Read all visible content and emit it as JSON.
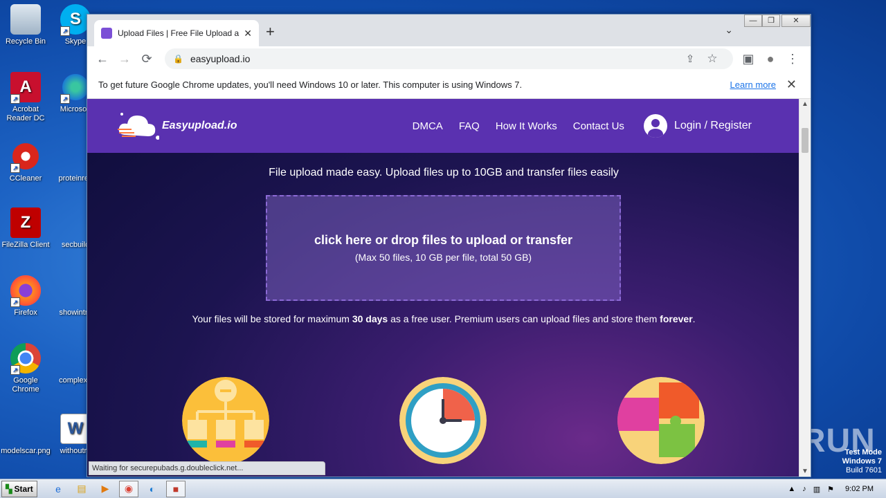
{
  "desktop": {
    "icons": [
      {
        "label": "Recycle Bin",
        "glyph": "🗑"
      },
      {
        "label": "Skype",
        "glyph": "S"
      },
      {
        "label": "Acrobat Reader DC",
        "glyph": "A"
      },
      {
        "label": "Microsoft",
        "glyph": "e"
      },
      {
        "label": "CCleaner",
        "glyph": "C"
      },
      {
        "label": "proteinrec",
        "glyph": ""
      },
      {
        "label": "FileZilla Client",
        "glyph": "Z"
      },
      {
        "label": "secbuild",
        "glyph": ""
      },
      {
        "label": "Firefox",
        "glyph": "🦊"
      },
      {
        "label": "showintro",
        "glyph": ""
      },
      {
        "label": "Google Chrome",
        "glyph": "◉"
      },
      {
        "label": "complextr",
        "glyph": ""
      },
      {
        "label": "modelscar.png",
        "glyph": ""
      },
      {
        "label": "withoutre",
        "glyph": "W"
      }
    ],
    "watermark": "ANY RUN",
    "testmode": {
      "line1": "Test Mode",
      "line2": "Windows 7",
      "line3": "Build 7601"
    }
  },
  "browser": {
    "tab_title": "Upload Files | Free File Upload and T",
    "tab_close": "✕",
    "new_tab": "+",
    "tab_search": "⌄",
    "url": "easyupload.io",
    "win_min": "—",
    "win_max": "❐",
    "win_close": "✕",
    "back": "←",
    "forward": "→",
    "reload": "⟳",
    "lock": "🔒",
    "share": "⇪",
    "star": "☆",
    "sidepanel": "▣",
    "profile": "●",
    "menu": "⋮",
    "infobar_text": "To get future Google Chrome updates, you'll need Windows 10 or later. This computer is using Windows 7.",
    "infobar_link": "Learn more",
    "infobar_close": "✕",
    "status": "Waiting for securepubads.g.doubleclick.net..."
  },
  "site": {
    "logo_text": "Easyupload.io",
    "nav": [
      "DMCA",
      "FAQ",
      "How It Works",
      "Contact Us"
    ],
    "login": "Login / Register",
    "tagline": "File upload made easy. Upload files up to 10GB and transfer files easily",
    "drop_main": "click here or drop files to upload or transfer",
    "drop_sub": "(Max 50 files, 10 GB per file, total 50 GB)",
    "storage_pre": "Your files will be stored for maximum ",
    "storage_days": "30 days",
    "storage_mid": " as a free user. Premium users can upload files and store them ",
    "storage_forever": "forever",
    "storage_end": "."
  },
  "taskbar": {
    "start": "Start",
    "time": "9:02 PM"
  }
}
